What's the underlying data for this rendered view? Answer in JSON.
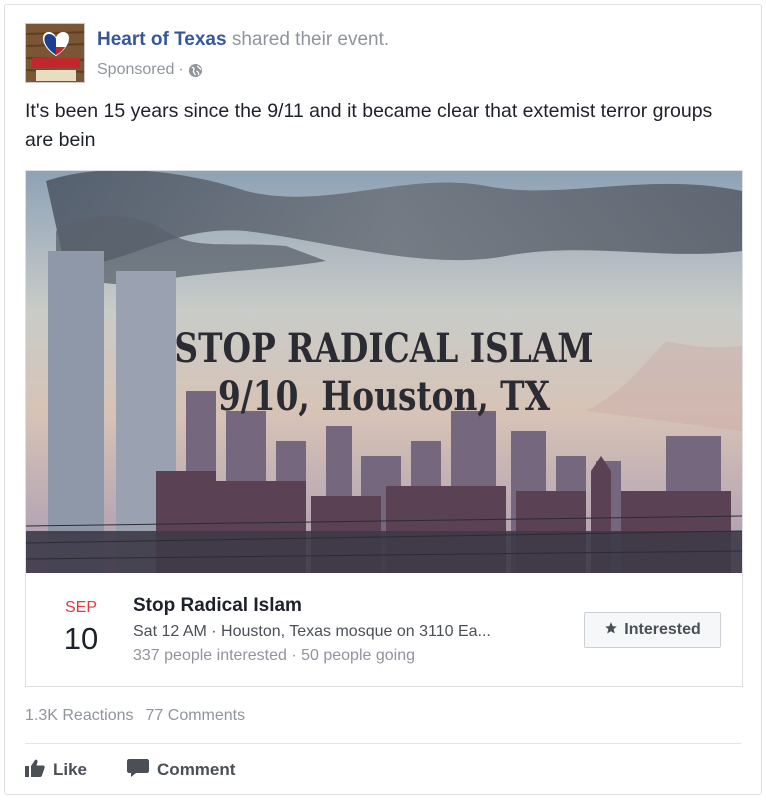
{
  "post": {
    "author": "Heart of Texas",
    "action_text": "shared their event.",
    "sponsored": "Sponsored",
    "separator": "·",
    "body": "It's been 15 years since the 9/11 and it became clear that extemist terror groups are bein"
  },
  "avatar": {
    "line1": "HEART",
    "line2": "OF",
    "line3": "TEXAS"
  },
  "event_image": {
    "caption_line1": "STOP RADICAL ISLAM",
    "caption_line2": "9/10, Houston, TX"
  },
  "event": {
    "month": "SEP",
    "day": "10",
    "title": "Stop Radical Islam",
    "details": "Sat 12 AM · Houston, Texas mosque on 3110 Ea...",
    "stats": "337 people interested · 50 people going",
    "interested_label": "Interested"
  },
  "engagement": {
    "reactions": "1.3K Reactions",
    "comments": "77 Comments"
  },
  "actions": {
    "like_label": "Like",
    "comment_label": "Comment"
  },
  "colors": {
    "link_blue": "#365899",
    "date_red": "#e0393e",
    "muted_gray": "#90949c"
  },
  "icons": [
    "globe-icon",
    "star-icon",
    "thumbs-up-icon",
    "comment-icon"
  ]
}
